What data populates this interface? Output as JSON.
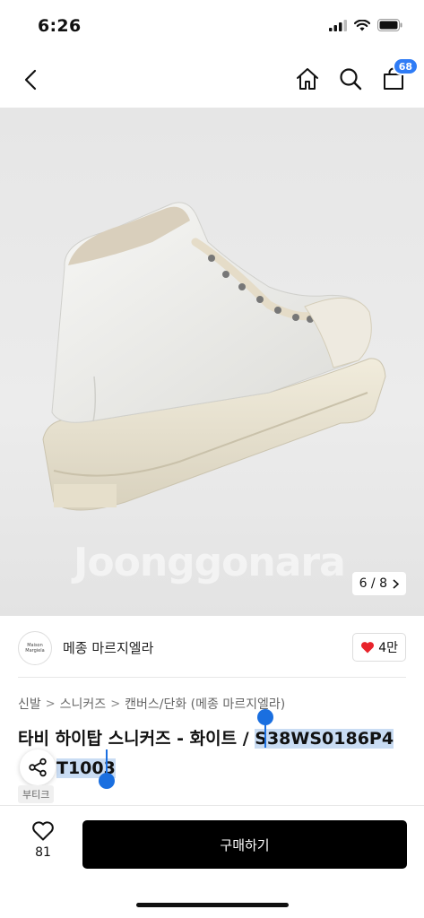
{
  "status": {
    "time": "6:26"
  },
  "nav": {
    "cart_count": "68"
  },
  "image": {
    "watermark": "Joonggonara",
    "counter": "6 / 8"
  },
  "brand": {
    "name": "메종 마르지엘라",
    "logo_text": "Maison Margiela",
    "likes": "4만"
  },
  "breadcrumb": [
    "신발",
    "스니커즈",
    "캔버스/단화 (메종 마르지엘라)"
  ],
  "product": {
    "title_plain": "타비 하이탑 스니커즈 - 화이트 / ",
    "title_selected": "S38WS0186P4",
    "title_selected_2": "T1003",
    "tag": "부티크"
  },
  "bottom": {
    "wish_count": "81",
    "buy_label": "구매하기"
  },
  "colors": {
    "accent": "#2f7cf6",
    "selection": "#c9dcf3",
    "buy_button": "#000000",
    "heart": "#e8232b"
  }
}
